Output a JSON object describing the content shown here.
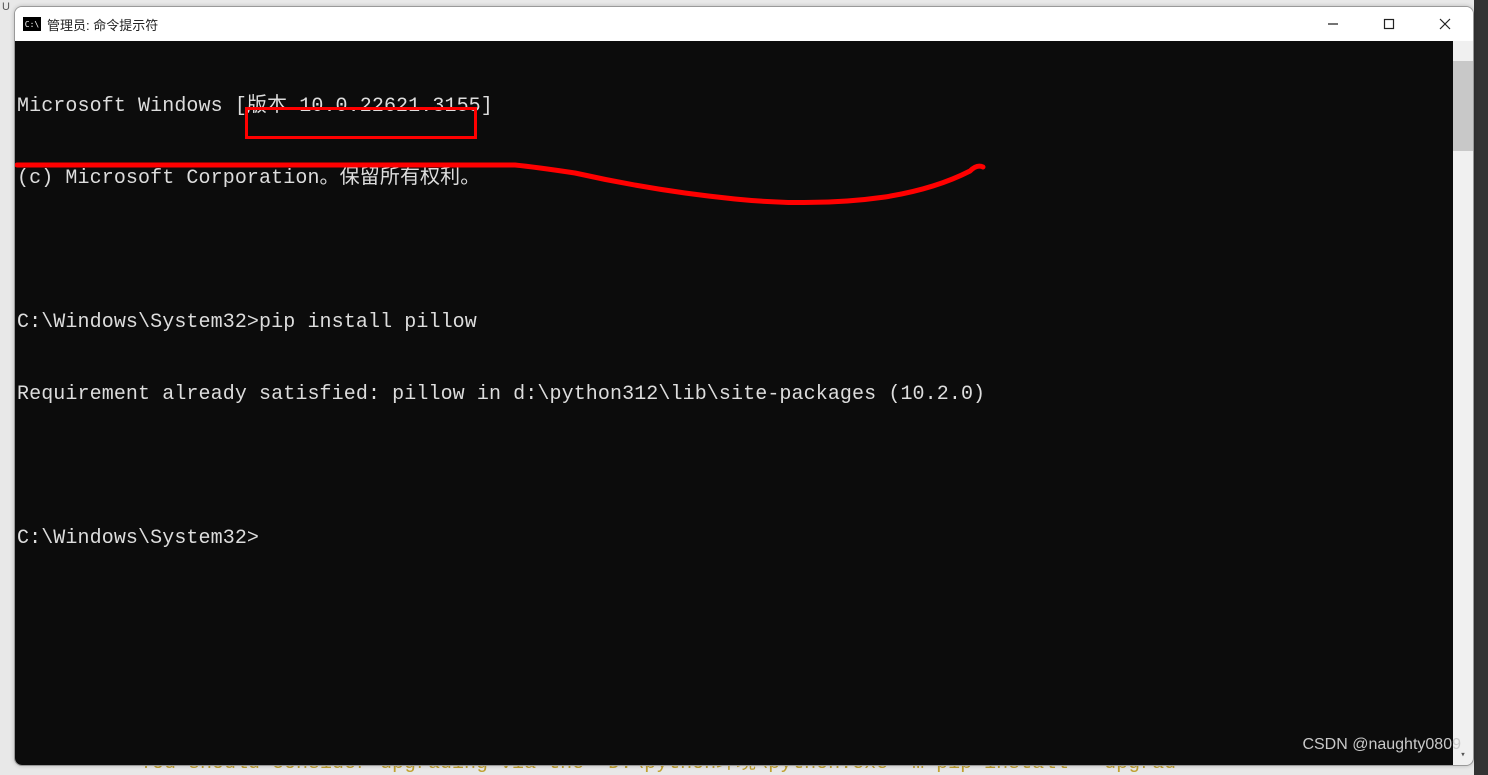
{
  "window": {
    "icon_text": "C:\\",
    "title": "管理员: 命令提示符"
  },
  "terminal": {
    "line1": "Microsoft Windows [版本 10.0.22621.3155]",
    "line2": "(c) Microsoft Corporation。保留所有权利。",
    "prompt1": "C:\\Windows\\System32>",
    "command1": "pip install pillow",
    "output1": "Requirement already satisfied: pillow in d:\\python312\\lib\\site-packages (10.2.0)",
    "prompt2": "C:\\Windows\\System32>"
  },
  "watermark": "CSDN @naughty0809",
  "bg_hint": "You should consider upgrading via the 'D:\\python环境\\python.exe -m pip install --upgrad"
}
